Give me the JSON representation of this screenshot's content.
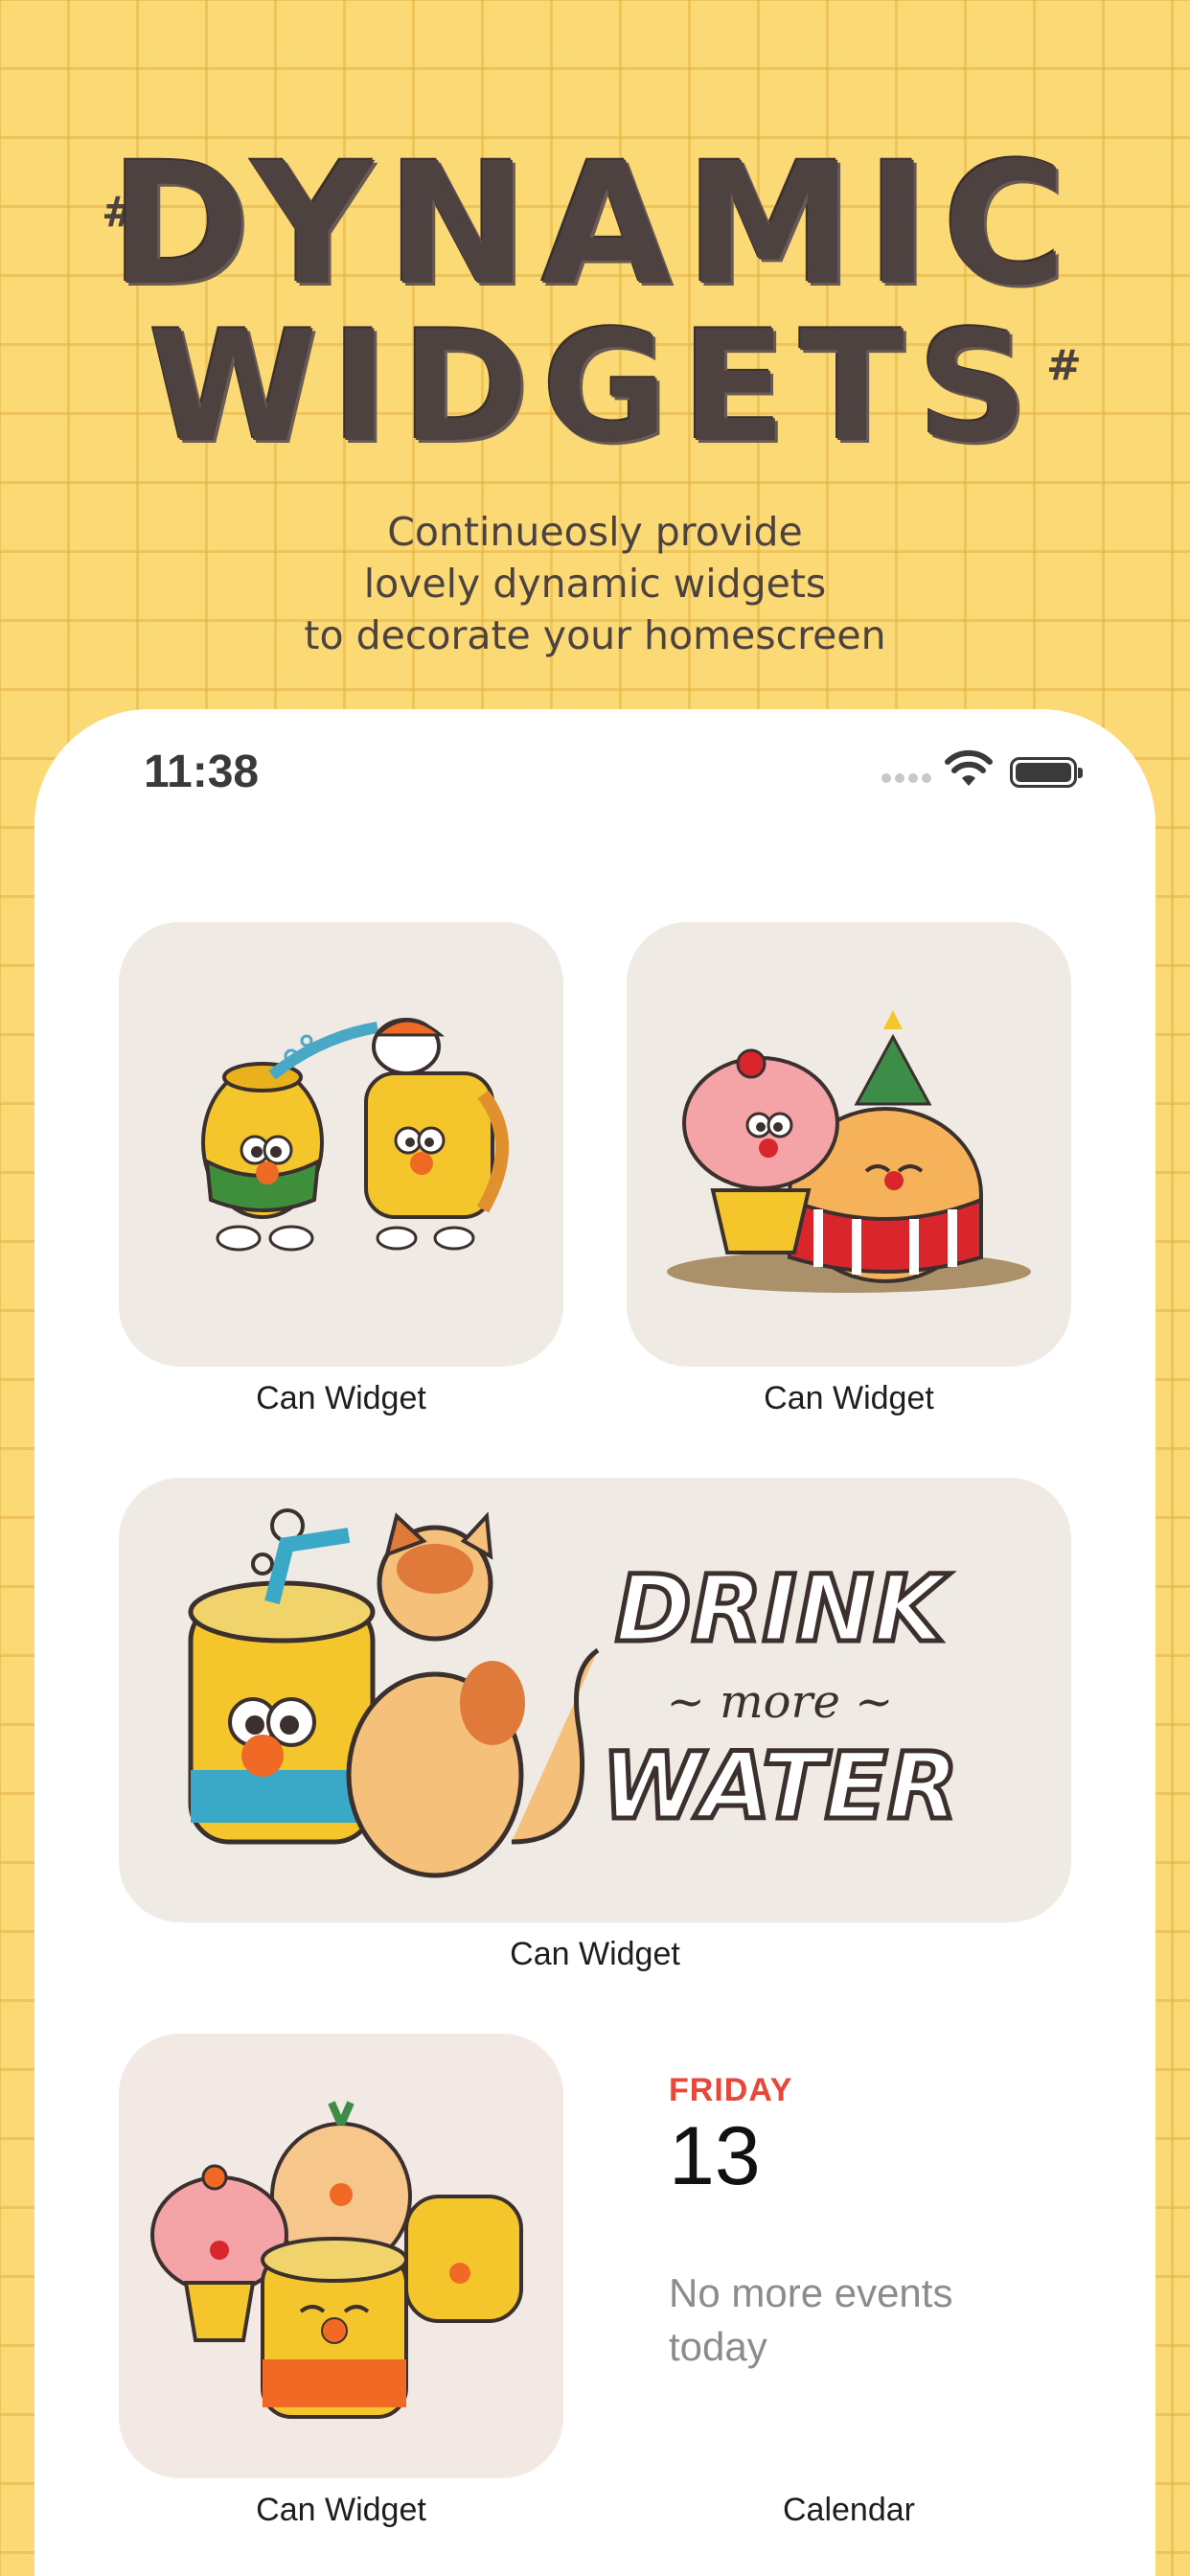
{
  "header": {
    "hash_left": "#",
    "hash_right": "#",
    "title_line1": "DYNAMIC",
    "title_line2": "WIDGETS",
    "subtitle_line1": "Continueosly provide",
    "subtitle_line2": "lovely dynamic widgets",
    "subtitle_line3": "to decorate your homescreen"
  },
  "status_bar": {
    "time": "11:38",
    "icons": [
      "cellular-signal-icon",
      "wifi-icon",
      "battery-icon"
    ]
  },
  "widgets": [
    {
      "label": "Can Widget",
      "art": "can-and-bread-characters"
    },
    {
      "label": "Can Widget",
      "art": "cupcake-and-christmas-bun-characters"
    },
    {
      "label": "Can Widget",
      "art": "can-and-cat-drink-more-water"
    },
    {
      "label": "Can Widget",
      "art": "group-of-four-characters"
    }
  ],
  "illustration_text": {
    "drink": "DRINK",
    "more": "~ more ~",
    "water": "WATER"
  },
  "calendar": {
    "day": "FRIDAY",
    "date": "13",
    "events": "No more events today",
    "label": "Calendar"
  },
  "colors": {
    "background": "#fbd974",
    "ink": "#4e4240",
    "calendar_accent": "#e8473a",
    "widget_bg": "#efebe4"
  }
}
